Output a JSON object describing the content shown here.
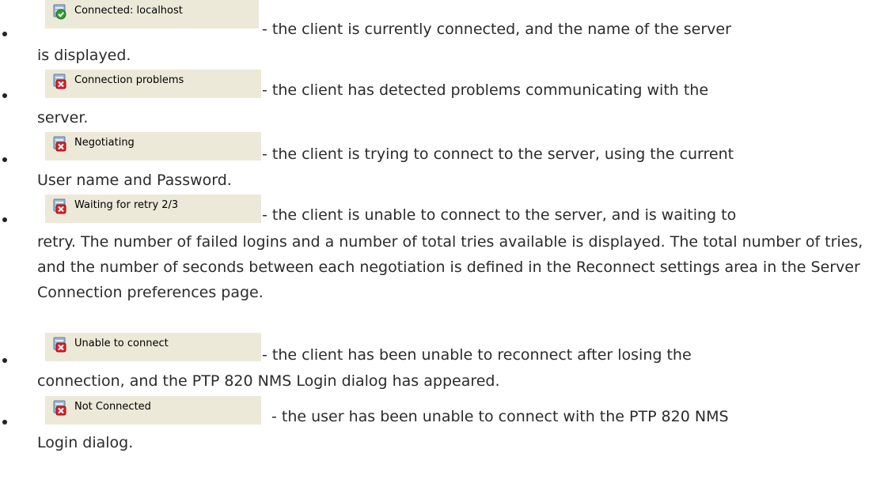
{
  "items": [
    {
      "status_label": "Connected: localhost",
      "icon": "connected-icon",
      "line1": "- the client is currently connected, and the name of the server",
      "cont": "is displayed."
    },
    {
      "status_label": "Connection problems",
      "icon": "error-icon",
      "line1": "- the client has detected problems communicating with the",
      "cont": "server."
    },
    {
      "status_label": "Negotiating",
      "icon": "error-icon",
      "line1": "- the client is trying to connect to the server, using the current",
      "cont": "User name and Password."
    },
    {
      "status_label": "Waiting for retry 2/3",
      "icon": "error-icon",
      "line1": "- the client is unable to connect to the server, and is waiting to",
      "cont": "retry. The number of failed logins and a number of total tries available is displayed. The total number of tries, and the number of seconds between each negotiation is defined in the Reconnect settings area in the Server Connection preferences page."
    },
    {
      "status_label": "Unable to connect",
      "icon": "error-icon",
      "line1": "- the client has been unable to reconnect after losing the",
      "cont": "connection, and the PTP 820 NMS Login dialog has appeared."
    },
    {
      "status_label": "Not Connected",
      "icon": "error-icon",
      "line1": "- the user has been unable to connect with the PTP 820 NMS",
      "cont": "Login dialog."
    }
  ],
  "colors": {
    "status_bg": "#ece9d8",
    "text": "#2b2b2b",
    "icon_ok": "#2e9e2e",
    "icon_error": "#d8232a"
  }
}
